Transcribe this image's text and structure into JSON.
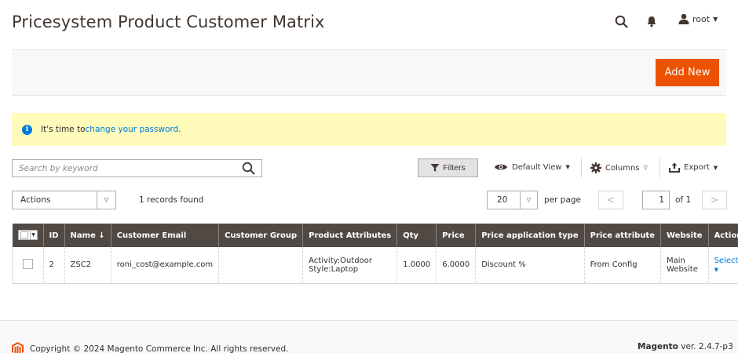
{
  "header": {
    "title": "Pricesystem Product Customer Matrix",
    "user_name": "root"
  },
  "page_actions": {
    "add_new_label": "Add New"
  },
  "message": {
    "text_before": "It's time to ",
    "link_text": "change your password",
    "text_after": "."
  },
  "toolbar": {
    "search_placeholder": "Search by keyword",
    "filters_label": "Filters",
    "view_label": "Default View",
    "columns_label": "Columns",
    "export_label": "Export",
    "actions_label": "Actions",
    "records_found": "1 records found",
    "per_page_value": "20",
    "per_page_label": "per page",
    "current_page": "1",
    "total_pages": "of 1"
  },
  "grid": {
    "columns": [
      "ID",
      "Name ↓",
      "Customer Email",
      "Customer Group",
      "Product Attributes",
      "Qty",
      "Price",
      "Price application type",
      "Price attribute",
      "Website",
      "Action"
    ],
    "rows": [
      {
        "id": "2",
        "name": "ZSC2",
        "email": "roni_cost@example.com",
        "group": "",
        "attr_line1": "Activity:Outdoor",
        "attr_line2": "Style:Laptop",
        "qty": "1.0000",
        "price": "6.0000",
        "application_type": "Discount %",
        "price_attribute": "From Config",
        "website": "Main Website",
        "action": "Select"
      }
    ]
  },
  "footer": {
    "copyright": "Copyright © 2024 Magento Commerce Inc. All rights reserved.",
    "brand": "Magento",
    "version": " ver. 2.4.7-p3"
  },
  "colors": {
    "accent": "#eb5202",
    "grid_header": "#514943",
    "link": "#007bdb",
    "message_bg": "#fffbbb"
  },
  "icons": {
    "search": "search-icon",
    "notifications": "bell-icon",
    "user": "user-icon",
    "info": "info-icon",
    "filter": "funnel-icon",
    "view": "eye-icon",
    "columns": "gear-icon",
    "export": "export-icon",
    "magento": "magento-logo-icon"
  }
}
